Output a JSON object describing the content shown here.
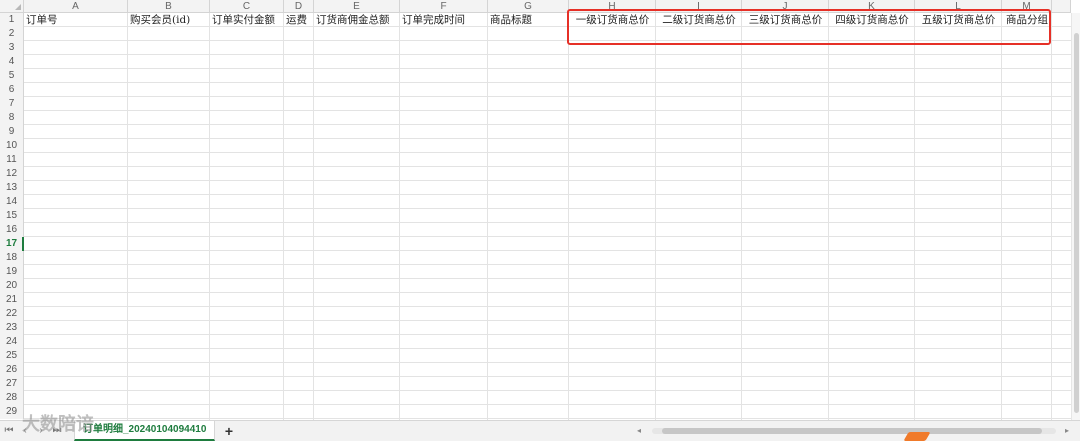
{
  "spreadsheet": {
    "column_letters": [
      "A",
      "B",
      "C",
      "D",
      "E",
      "F",
      "G",
      "H",
      "I",
      "J",
      "K",
      "L",
      "M"
    ],
    "row_numbers": [
      "1",
      "2",
      "3",
      "4",
      "5",
      "6",
      "7",
      "8",
      "9",
      "10",
      "11",
      "12",
      "13",
      "14",
      "15",
      "16",
      "17",
      "18",
      "19",
      "20",
      "21",
      "22",
      "23",
      "24",
      "25",
      "26",
      "27",
      "28",
      "29"
    ],
    "active_row": "17",
    "header_row": [
      "订单号",
      "购买会员(id)",
      "订单实付金额",
      "运费",
      "订货商佣金总额",
      "订单完成时间",
      "商品标题",
      "一级订货商总价",
      "二级订货商总价",
      "三级订货商总价",
      "四级订货商总价",
      "五级订货商总价",
      "商品分组"
    ]
  },
  "sheet_tabs": {
    "active_tab_label": "订单明细_20240104094410",
    "add_sheet_label": "+",
    "nav_first": "⏮",
    "nav_prev": "‹",
    "nav_next": "›",
    "nav_last": "⏭"
  },
  "scrollbar": {
    "left_arrow": "◂",
    "right_arrow": "▸"
  },
  "watermark": {
    "text": "大数陪谙"
  },
  "colors": {
    "highlight_box": "#e63027",
    "accent_green": "#1e7c3e"
  }
}
